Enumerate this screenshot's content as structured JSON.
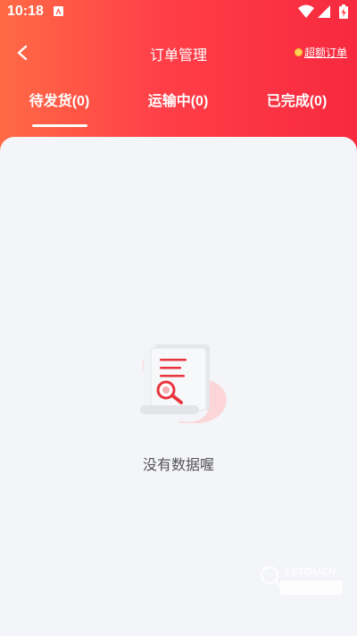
{
  "status_bar": {
    "time": "10:18"
  },
  "navbar": {
    "title": "订单管理",
    "excess_orders_label": "超额订单"
  },
  "tabs": [
    {
      "label": "待发货(0)",
      "active": true
    },
    {
      "label": "运输中(0)",
      "active": false
    },
    {
      "label": "已完成(0)",
      "active": false
    }
  ],
  "empty_state": {
    "message": "没有数据喔"
  },
  "watermark": {
    "text": "18TOUCH"
  },
  "colors": {
    "header_start": "#ff6a45",
    "header_end": "#f7293f",
    "accent_red": "#e8343c",
    "background": "#f4f5f9"
  }
}
